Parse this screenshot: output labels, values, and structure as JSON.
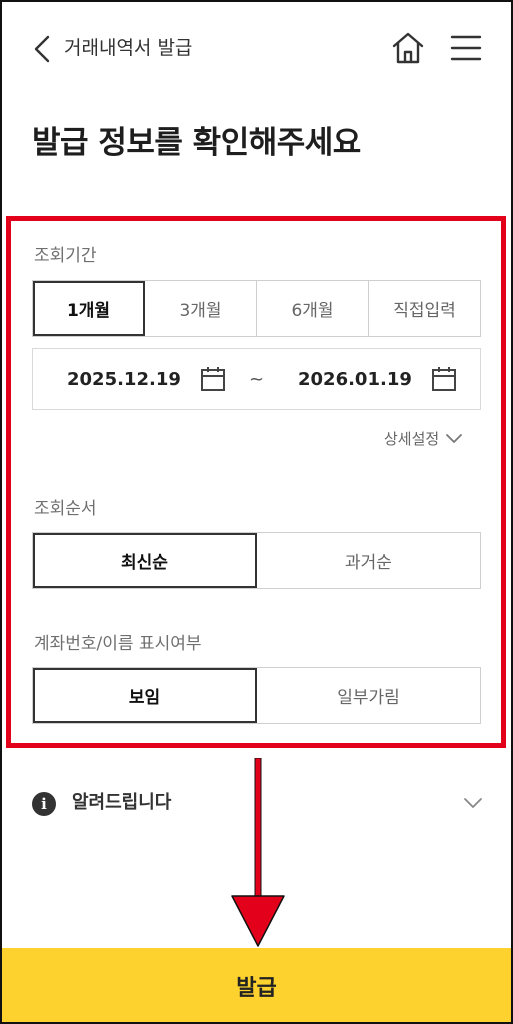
{
  "header": {
    "title": "거래내역서 발급"
  },
  "page": {
    "title": "발급 정보를 확인해주세요"
  },
  "period": {
    "label": "조회기간",
    "options": [
      "1개월",
      "3개월",
      "6개월",
      "직접입력"
    ],
    "selected": "1개월",
    "start_date": "2025.12.19",
    "separator": "~",
    "end_date": "2026.01.19",
    "detail_label": "상세설정"
  },
  "order": {
    "label": "조회순서",
    "options": [
      "최신순",
      "과거순"
    ],
    "selected": "최신순"
  },
  "display": {
    "label": "계좌번호/이름 표시여부",
    "options": [
      "보임",
      "일부가림"
    ],
    "selected": "보임"
  },
  "notice": {
    "icon": "i",
    "label": "알려드립니다"
  },
  "action": {
    "issue_label": "발급"
  },
  "colors": {
    "highlight": "#e3001b",
    "accent_button": "#fdd22e"
  }
}
